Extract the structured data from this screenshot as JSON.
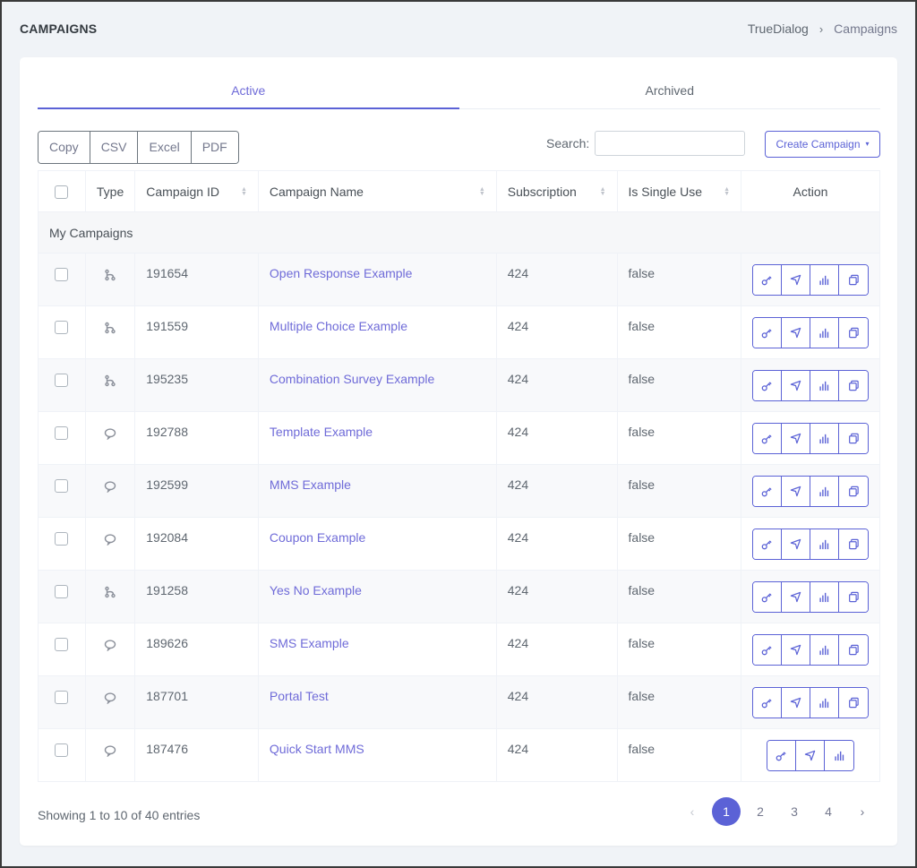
{
  "header": {
    "title": "CAMPAIGNS",
    "breadcrumb": [
      "TrueDialog",
      "Campaigns"
    ],
    "breadcrumb_separator": "›"
  },
  "tabs": [
    {
      "label": "Active",
      "active": true
    },
    {
      "label": "Archived",
      "active": false
    }
  ],
  "toolbar": {
    "export_buttons": [
      "Copy",
      "CSV",
      "Excel",
      "PDF"
    ],
    "search_label": "Search:",
    "search_value": "",
    "create_label": "Create Campaign",
    "create_caret": "▾"
  },
  "table": {
    "columns": [
      "Type",
      "Campaign ID",
      "Campaign Name",
      "Subscription",
      "Is Single Use",
      "Action"
    ],
    "group_label": "My Campaigns",
    "rows": [
      {
        "type": "survey",
        "id": "191654",
        "name": "Open Response Example",
        "subscription": "424",
        "single_use": "false",
        "actions": [
          "key",
          "send",
          "stats",
          "copy"
        ]
      },
      {
        "type": "survey",
        "id": "191559",
        "name": "Multiple Choice Example",
        "subscription": "424",
        "single_use": "false",
        "actions": [
          "key",
          "send",
          "stats",
          "copy"
        ]
      },
      {
        "type": "survey",
        "id": "195235",
        "name": "Combination Survey Example",
        "subscription": "424",
        "single_use": "false",
        "actions": [
          "key",
          "send",
          "stats",
          "copy"
        ]
      },
      {
        "type": "message",
        "id": "192788",
        "name": "Template Example",
        "subscription": "424",
        "single_use": "false",
        "actions": [
          "key",
          "send",
          "stats",
          "copy"
        ]
      },
      {
        "type": "message",
        "id": "192599",
        "name": "MMS Example",
        "subscription": "424",
        "single_use": "false",
        "actions": [
          "key",
          "send",
          "stats",
          "copy"
        ]
      },
      {
        "type": "message",
        "id": "192084",
        "name": "Coupon Example",
        "subscription": "424",
        "single_use": "false",
        "actions": [
          "key",
          "send",
          "stats",
          "copy"
        ]
      },
      {
        "type": "survey",
        "id": "191258",
        "name": "Yes No Example",
        "subscription": "424",
        "single_use": "false",
        "actions": [
          "key",
          "send",
          "stats",
          "copy"
        ]
      },
      {
        "type": "message",
        "id": "189626",
        "name": "SMS Example",
        "subscription": "424",
        "single_use": "false",
        "actions": [
          "key",
          "send",
          "stats",
          "copy"
        ]
      },
      {
        "type": "message",
        "id": "187701",
        "name": "Portal Test",
        "subscription": "424",
        "single_use": "false",
        "actions": [
          "key",
          "send",
          "stats",
          "copy"
        ]
      },
      {
        "type": "message",
        "id": "187476",
        "name": "Quick Start MMS",
        "subscription": "424",
        "single_use": "false",
        "actions": [
          "key",
          "send",
          "stats"
        ]
      }
    ]
  },
  "footer": {
    "info": "Showing 1 to 10 of 40 entries",
    "pages": [
      "1",
      "2",
      "3",
      "4"
    ],
    "current_page": "1",
    "prev": "‹",
    "next": "›"
  },
  "colors": {
    "accent": "#5b62d6",
    "link": "#6f6bd8",
    "background": "#f0f3f7"
  }
}
